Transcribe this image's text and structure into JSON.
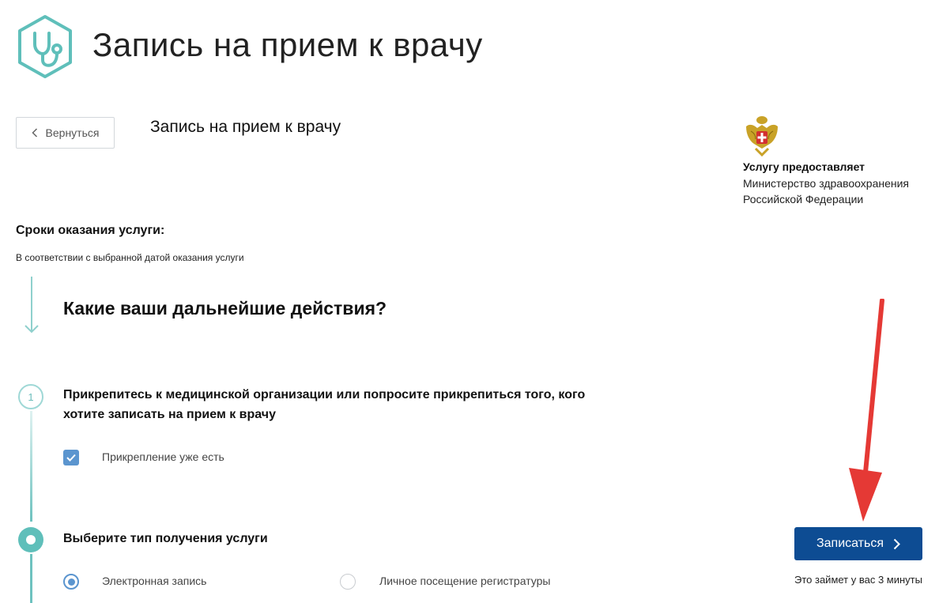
{
  "header": {
    "title": "Запись на прием к врачу",
    "logo_icon": "stethoscope-icon",
    "accent_color": "#5fbfba"
  },
  "back_button": {
    "label": "Вернуться",
    "icon": "chevron-left-icon"
  },
  "service": {
    "title": "Запись на прием к врачу"
  },
  "provider": {
    "label": "Услугу предоставляет",
    "name_line1": "Министерство здравоохранения",
    "name_line2": "Российской Федерации",
    "emblem_icon": "coat-of-arms-icon"
  },
  "timing": {
    "heading": "Сроки оказания услуги:",
    "text": "В соответствии с выбранной датой оказания услуги"
  },
  "actions": {
    "heading": "Какие ваши дальнейшие действия?"
  },
  "step1": {
    "number": "1",
    "text": "Прикрепитесь к медицинской организации или попросите прикрепиться того, кого хотите записать на прием к врачу",
    "checkbox_label": "Прикрепление уже есть",
    "checkbox_checked": true
  },
  "step2": {
    "text": "Выберите тип получения услуги",
    "options": [
      {
        "label": "Электронная запись",
        "selected": true
      },
      {
        "label": "Личное посещение регистратуры",
        "selected": false
      }
    ]
  },
  "submit": {
    "label": "Записаться",
    "icon": "chevron-right-icon",
    "color": "#0d4c93",
    "note": "Это займет у вас 3 минуты"
  },
  "annotation": {
    "color": "#e53935",
    "icon": "red-arrow-icon"
  }
}
